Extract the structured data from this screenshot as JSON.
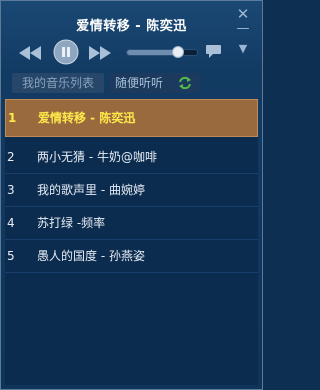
{
  "window": {
    "title": "爱情转移 - 陈奕迅",
    "close_glyph": "✕",
    "minimize_glyph": "—",
    "collapse_glyph": "▼"
  },
  "player": {
    "volume_fraction": 0.72,
    "icons": [
      "previous-icon",
      "pause-icon",
      "next-icon",
      "chat-bubble-icon"
    ]
  },
  "tabs": [
    {
      "label": "我的音乐列表",
      "selected": false
    },
    {
      "label": "随便听听",
      "selected": true,
      "icon": "refresh-icon"
    }
  ],
  "playlist": [
    {
      "index": "1",
      "title": "爱情转移 - 陈奕迅",
      "active": true
    },
    {
      "index": "2",
      "title": "两小无猜 - 牛奶@咖啡",
      "active": false
    },
    {
      "index": "3",
      "title": "我的歌声里 - 曲婉婷",
      "active": false
    },
    {
      "index": "4",
      "title": "苏打绿 -频率",
      "active": false
    },
    {
      "index": "5",
      "title": "愚人的国度 - 孙燕姿",
      "active": false
    }
  ],
  "colors": {
    "background": "#0f3459",
    "active_row": "#9a6a3f",
    "active_text": "#ffe94a",
    "refresh_icon": "#54b948"
  }
}
